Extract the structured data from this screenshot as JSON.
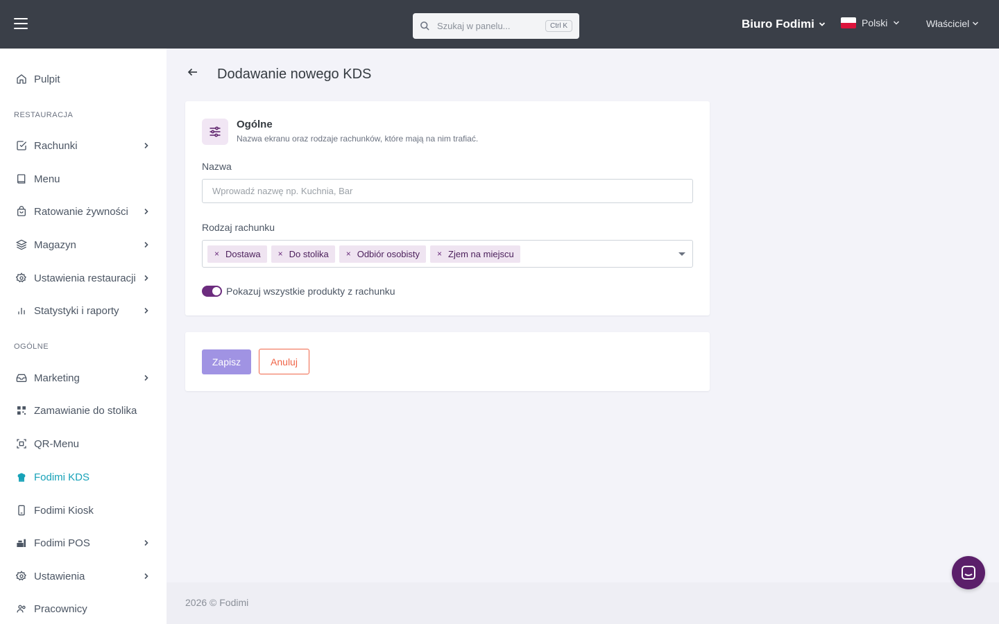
{
  "header": {
    "menu_icon": "hamburger-icon",
    "search": {
      "placeholder": "Szukaj w panelu...",
      "shortcut": "Ctrl K"
    },
    "organization": "Biuro Fodimi",
    "language": "Polski",
    "role": "Właściciel"
  },
  "sidebar": {
    "items": [
      {
        "label": "Pulpit",
        "icon": "home-icon",
        "has_submenu": false
      },
      {
        "label": "Rachunki",
        "icon": "check-square-icon",
        "has_submenu": true
      },
      {
        "label": "Menu",
        "icon": "book-icon",
        "has_submenu": false
      },
      {
        "label": "Ratowanie żywności",
        "icon": "shopping-bag-icon",
        "has_submenu": true
      },
      {
        "label": "Magazyn",
        "icon": "layers-icon",
        "has_submenu": true
      },
      {
        "label": "Ustawienia restauracji",
        "icon": "gear-icon",
        "has_submenu": true
      },
      {
        "label": "Statystyki i raporty",
        "icon": "bar-chart-icon",
        "has_submenu": true
      },
      {
        "label": "Marketing",
        "icon": "inbox-icon",
        "has_submenu": true
      },
      {
        "label": "Zamawianie do stolika",
        "icon": "qr-code-icon",
        "has_submenu": false
      },
      {
        "label": "QR-Menu",
        "icon": "qr-scan-icon",
        "has_submenu": false
      },
      {
        "label": "Fodimi KDS",
        "icon": "chef-hat-icon",
        "has_submenu": false,
        "active": true
      },
      {
        "label": "Fodimi Kiosk",
        "icon": "kiosk-icon",
        "has_submenu": false
      },
      {
        "label": "Fodimi POS",
        "icon": "pos-icon",
        "has_submenu": true
      },
      {
        "label": "Ustawienia",
        "icon": "gear-icon",
        "has_submenu": true
      },
      {
        "label": "Pracownicy",
        "icon": "users-icon",
        "has_submenu": false
      }
    ],
    "sections": {
      "restaurant": "RESTAURACJA",
      "general": "OGÓLNE"
    },
    "active_color": "#17a2b8"
  },
  "page": {
    "title": "Dodawanie nowego KDS",
    "general_section": {
      "title": "Ogólne",
      "description": "Nazwa ekranu oraz rodzaje rachunków, które mają na nim trafiać."
    },
    "name_field": {
      "label": "Nazwa",
      "value": "",
      "placeholder": "Wprowadź nazwę np. Kuchnia, Bar"
    },
    "order_type_field": {
      "label": "Rodzaj rachunku",
      "selected": [
        "Dostawa",
        "Do stolika",
        "Odbiór osobisty",
        "Zjem na miejscu"
      ]
    },
    "toggle": {
      "label": "Pokazuj wszystkie produkty z rachunku",
      "on": true
    },
    "buttons": {
      "save": "Zapisz",
      "cancel": "Anuluj"
    }
  },
  "footer": {
    "text": "2026 © Fodimi"
  },
  "colors": {
    "topbar": "#3a3f48",
    "accent_purple": "#6c2c7e",
    "save_button": "#a093e3",
    "cancel_button": "#f06548"
  }
}
